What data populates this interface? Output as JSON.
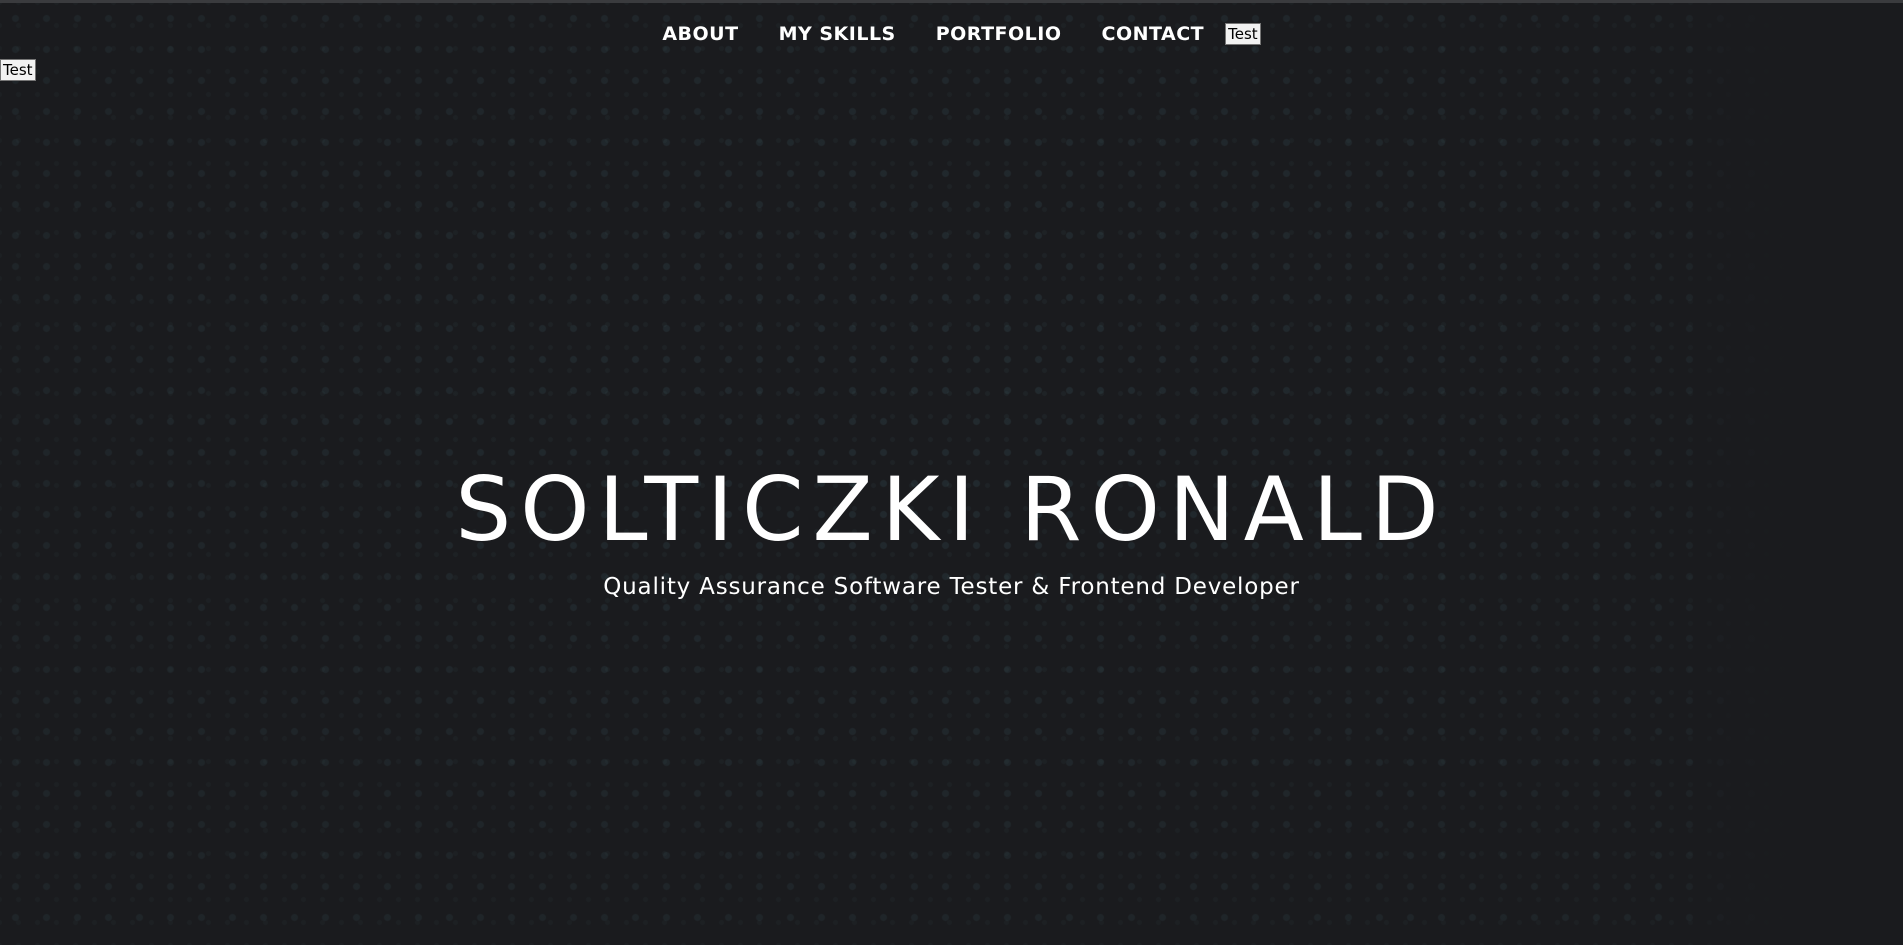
{
  "nav": {
    "items": [
      {
        "label": "ABOUT"
      },
      {
        "label": "MY SKILLS"
      },
      {
        "label": "PORTFOLIO"
      },
      {
        "label": "CONTACT"
      }
    ],
    "test_button": "Test"
  },
  "corner_test_button": "Test",
  "hero": {
    "title": "SOLTICZKI RONALD",
    "subtitle": "Quality Assurance Software Tester & Frontend Developer"
  },
  "colors": {
    "background": "#1a1b1e",
    "text": "#ffffff",
    "pattern_dots": "#466e78"
  }
}
